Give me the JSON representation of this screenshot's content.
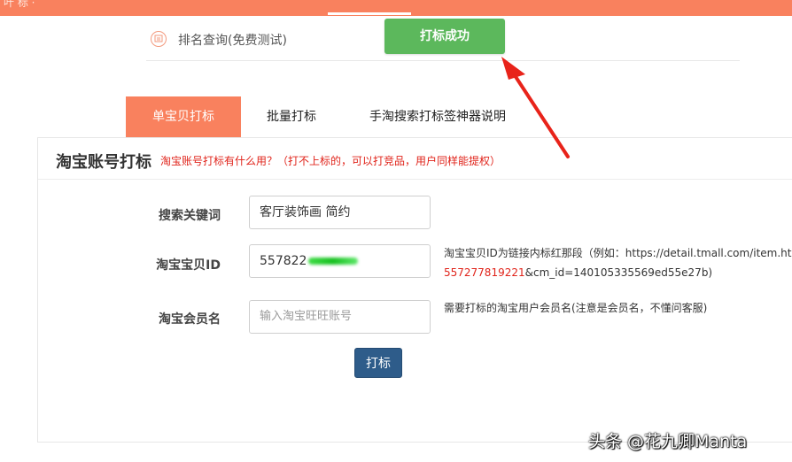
{
  "topbar": {
    "nav_text": "叶 标 ·"
  },
  "rank": {
    "label": "排名查询(免费测试)",
    "icon": "rank-medal-icon"
  },
  "success_button": {
    "label": "打标成功",
    "color": "#5cb85c"
  },
  "tabs": [
    {
      "label": "单宝贝打标",
      "active": true
    },
    {
      "label": "批量打标",
      "active": false
    },
    {
      "label": "手淘搜索打标签神器说明",
      "active": false
    }
  ],
  "panel": {
    "title": "淘宝账号打标",
    "hint": "淘宝账号打标有什么用？（打不上标的，可以打竞品，用户同样能提权）"
  },
  "form": {
    "keyword": {
      "label": "搜索关键词",
      "value": "客厅装饰画 简约"
    },
    "item_id": {
      "label": "淘宝宝贝ID",
      "value": "557822",
      "help_line1": "淘宝宝贝ID为链接内标红那段（例如：https://detail.tmall.com/item.htm",
      "help_red": "557277819221",
      "help_line2_rest": "&cm_id=140105335569ed55e27b)"
    },
    "member": {
      "label": "淘宝会员名",
      "placeholder": "输入淘宝旺旺账号",
      "help": "需要打标的淘宝用户会员名(注意是会员名，不懂问客服)"
    },
    "submit_label": "打标"
  },
  "colors": {
    "accent": "#f9815e",
    "submit": "#2e5c8a",
    "hint_red": "#e0231a"
  },
  "watermark": "头条 @花九卿Manta"
}
